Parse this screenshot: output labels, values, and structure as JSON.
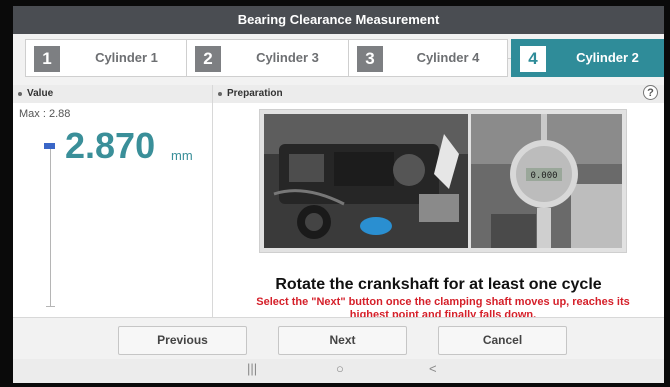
{
  "title": "Bearing Clearance Measurement",
  "steps": [
    {
      "num": "1",
      "label": "Cylinder 1",
      "active": false
    },
    {
      "num": "2",
      "label": "Cylinder 3",
      "active": false
    },
    {
      "num": "3",
      "label": "Cylinder 4",
      "active": false
    },
    {
      "num": "4",
      "label": "Cylinder 2",
      "active": true
    }
  ],
  "value_panel": {
    "header": "Value",
    "max_label": "Max : 2.88",
    "value": "2.870",
    "unit": "mm"
  },
  "prep_panel": {
    "header": "Preparation",
    "help_icon": "?",
    "instruction_title": "Rotate the crankshaft for at least one cycle",
    "instruction_text": "Select the \"Next\" button once the clamping shaft moves up, reaches its highest point and finally falls down."
  },
  "gauge_display": "0.000",
  "buttons": {
    "previous": "Previous",
    "next": "Next",
    "cancel": "Cancel"
  },
  "system_nav": {
    "recents": "|||",
    "home": "○",
    "back": "<"
  },
  "colors": {
    "accent": "#2f8c99",
    "title_bar": "#4a4d52",
    "instruction_red": "#d5202a",
    "marker_blue": "#3a66c7"
  }
}
